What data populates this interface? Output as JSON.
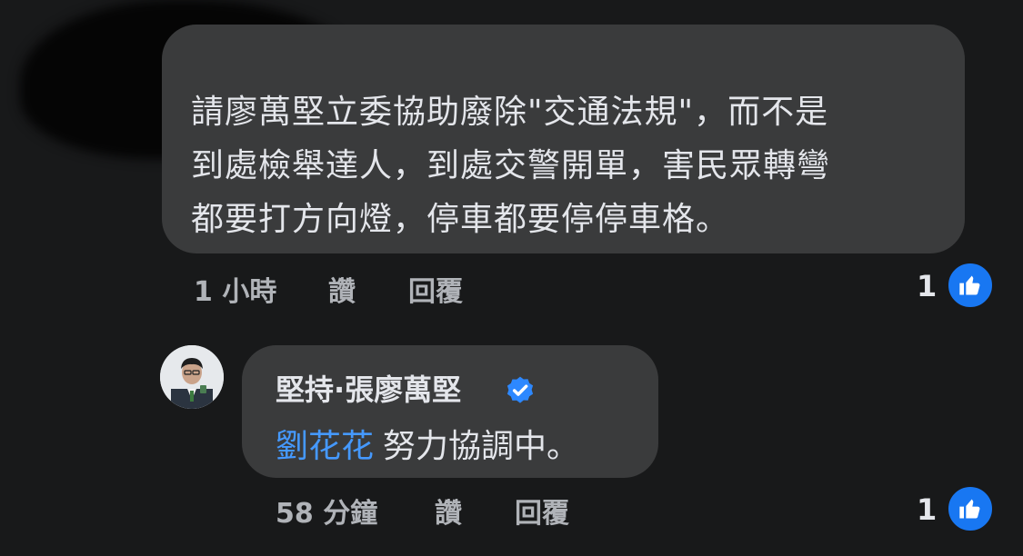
{
  "comment": {
    "author_redacted": true,
    "text": "請廖萬堅立委協助廢除\"交通法規\"，而不是\n到處檢舉達人，到處交警開單，害民眾轉彎\n都要打方向燈，停車都要停停車格。",
    "time": "1 小時",
    "like_label": "讚",
    "reply_label": "回覆",
    "reaction_count": "1",
    "reaction_icon": "thumbs-up-icon"
  },
  "reply": {
    "author": "堅持·張廖萬堅",
    "verified_icon": "verified-badge-icon",
    "mention": "劉花花",
    "text": "努力協調中。",
    "time": "58 分鐘",
    "like_label": "讚",
    "reply_label": "回覆",
    "reaction_count": "1",
    "reaction_icon": "thumbs-up-icon"
  },
  "colors": {
    "background": "#18191a",
    "bubble": "#3a3b3c",
    "text": "#e4e6eb",
    "secondary_text": "#b0b3b8",
    "mention": "#4599ff",
    "like_blue": "#1877f2"
  }
}
